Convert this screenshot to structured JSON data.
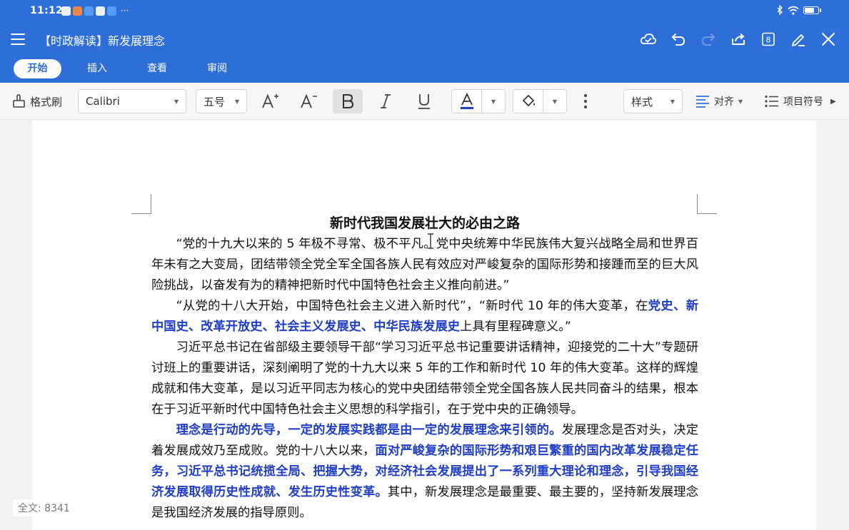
{
  "status_bar": {
    "time": "11:12",
    "more": "···"
  },
  "title_bar": {
    "title": "【时政解读】新发展理念"
  },
  "tabs": [
    "开始",
    "插入",
    "查看",
    "审阅"
  ],
  "toolbar": {
    "format_painter": "格式刷",
    "font_name": "Calibri",
    "font_size": "五号",
    "style": "样式",
    "align": "对齐",
    "bullets": "项目符号"
  },
  "document": {
    "heading": "新时代我国发展壮大的必由之路",
    "p1": "“党的十九大以来的 5 年极不寻常、极不平凡。党中央统筹中华民族伟大复兴战略全局和世界百年未有之大变局，团结带领全党全军全国各族人民有效应对严峻复杂的国际形势和接踵而至的巨大风险挑战，以奋发有为的精神把新时代中国特色社会主义推向前进。”",
    "p2a": "“从党的十八大开始，中国特色社会主义进入新时代”，“新时代 10 年的伟大变革，在",
    "p2b": "党史、新中国史、改革开放史、社会主义发展史、中华民族发展史",
    "p2c": "上具有里程碑意义。”",
    "p3": "习近平总书记在省部级主要领导干部“学习习近平总书记重要讲话精神，迎接党的二十大”专题研讨班上的重要讲话，深刻阐明了党的十九大以来 5 年的工作和新时代 10 年的伟大变革。这样的辉煌成就和伟大变革，是以习近平同志为核心的党中央团结带领全党全国各族人民共同奋斗的结果，根本在于习近平新时代中国特色社会主义思想的科学指引，在于党中央的正确领导。",
    "p4a": "理念是行动的先导，一定的发展实践都是由一定的发展理念来引领的。",
    "p4b": "发展理念是否对头，决定着发展成效乃至成败。党的十八大以来，",
    "p4c": "面对严峻复杂的国际形势和艰巨繁重的国内改革发展稳定任务，习近平总书记统揽全局、把握大势，对经济社会发展提出了一系列重大理论和理念，引导我国经济发展取得历史性成就、发生历史性变革。",
    "p4d": "其中，新发展理念是最重要、最主要的，坚持新发展理念是我国经济发展的指导原则。"
  },
  "word_count": "全文: 8341",
  "colors": {
    "brand": "#2e6ed9",
    "highlight_text": "#1f3fc9"
  },
  "battery_level": 0.75
}
